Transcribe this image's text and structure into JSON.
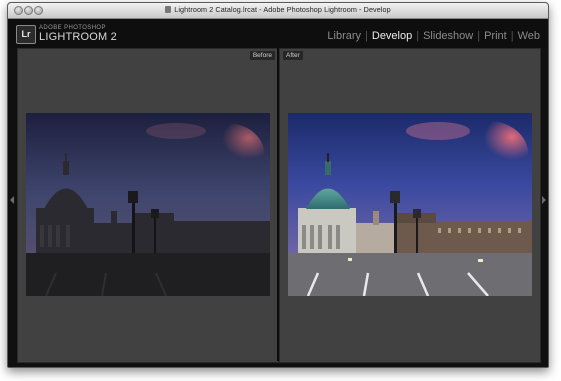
{
  "window": {
    "title": "Lightroom 2 Catalog.lrcat - Adobe Photoshop Lightroom - Develop"
  },
  "identity": {
    "badge": "Lr",
    "brand_top": "ADOBE PHOTOSHOP",
    "brand_main": "LIGHTROOM 2"
  },
  "modules": {
    "items": [
      "Library",
      "Develop",
      "Slideshow",
      "Print",
      "Web"
    ],
    "active": "Develop"
  },
  "panes": {
    "before_label": "Before",
    "after_label": "After"
  },
  "colors": {
    "active_module": "#ececec",
    "inactive_module": "#8c8c8c",
    "pane_bg": "#414141"
  },
  "icons": [
    "doc-icon",
    "left-panel-arrow-icon",
    "right-panel-arrow-icon"
  ]
}
